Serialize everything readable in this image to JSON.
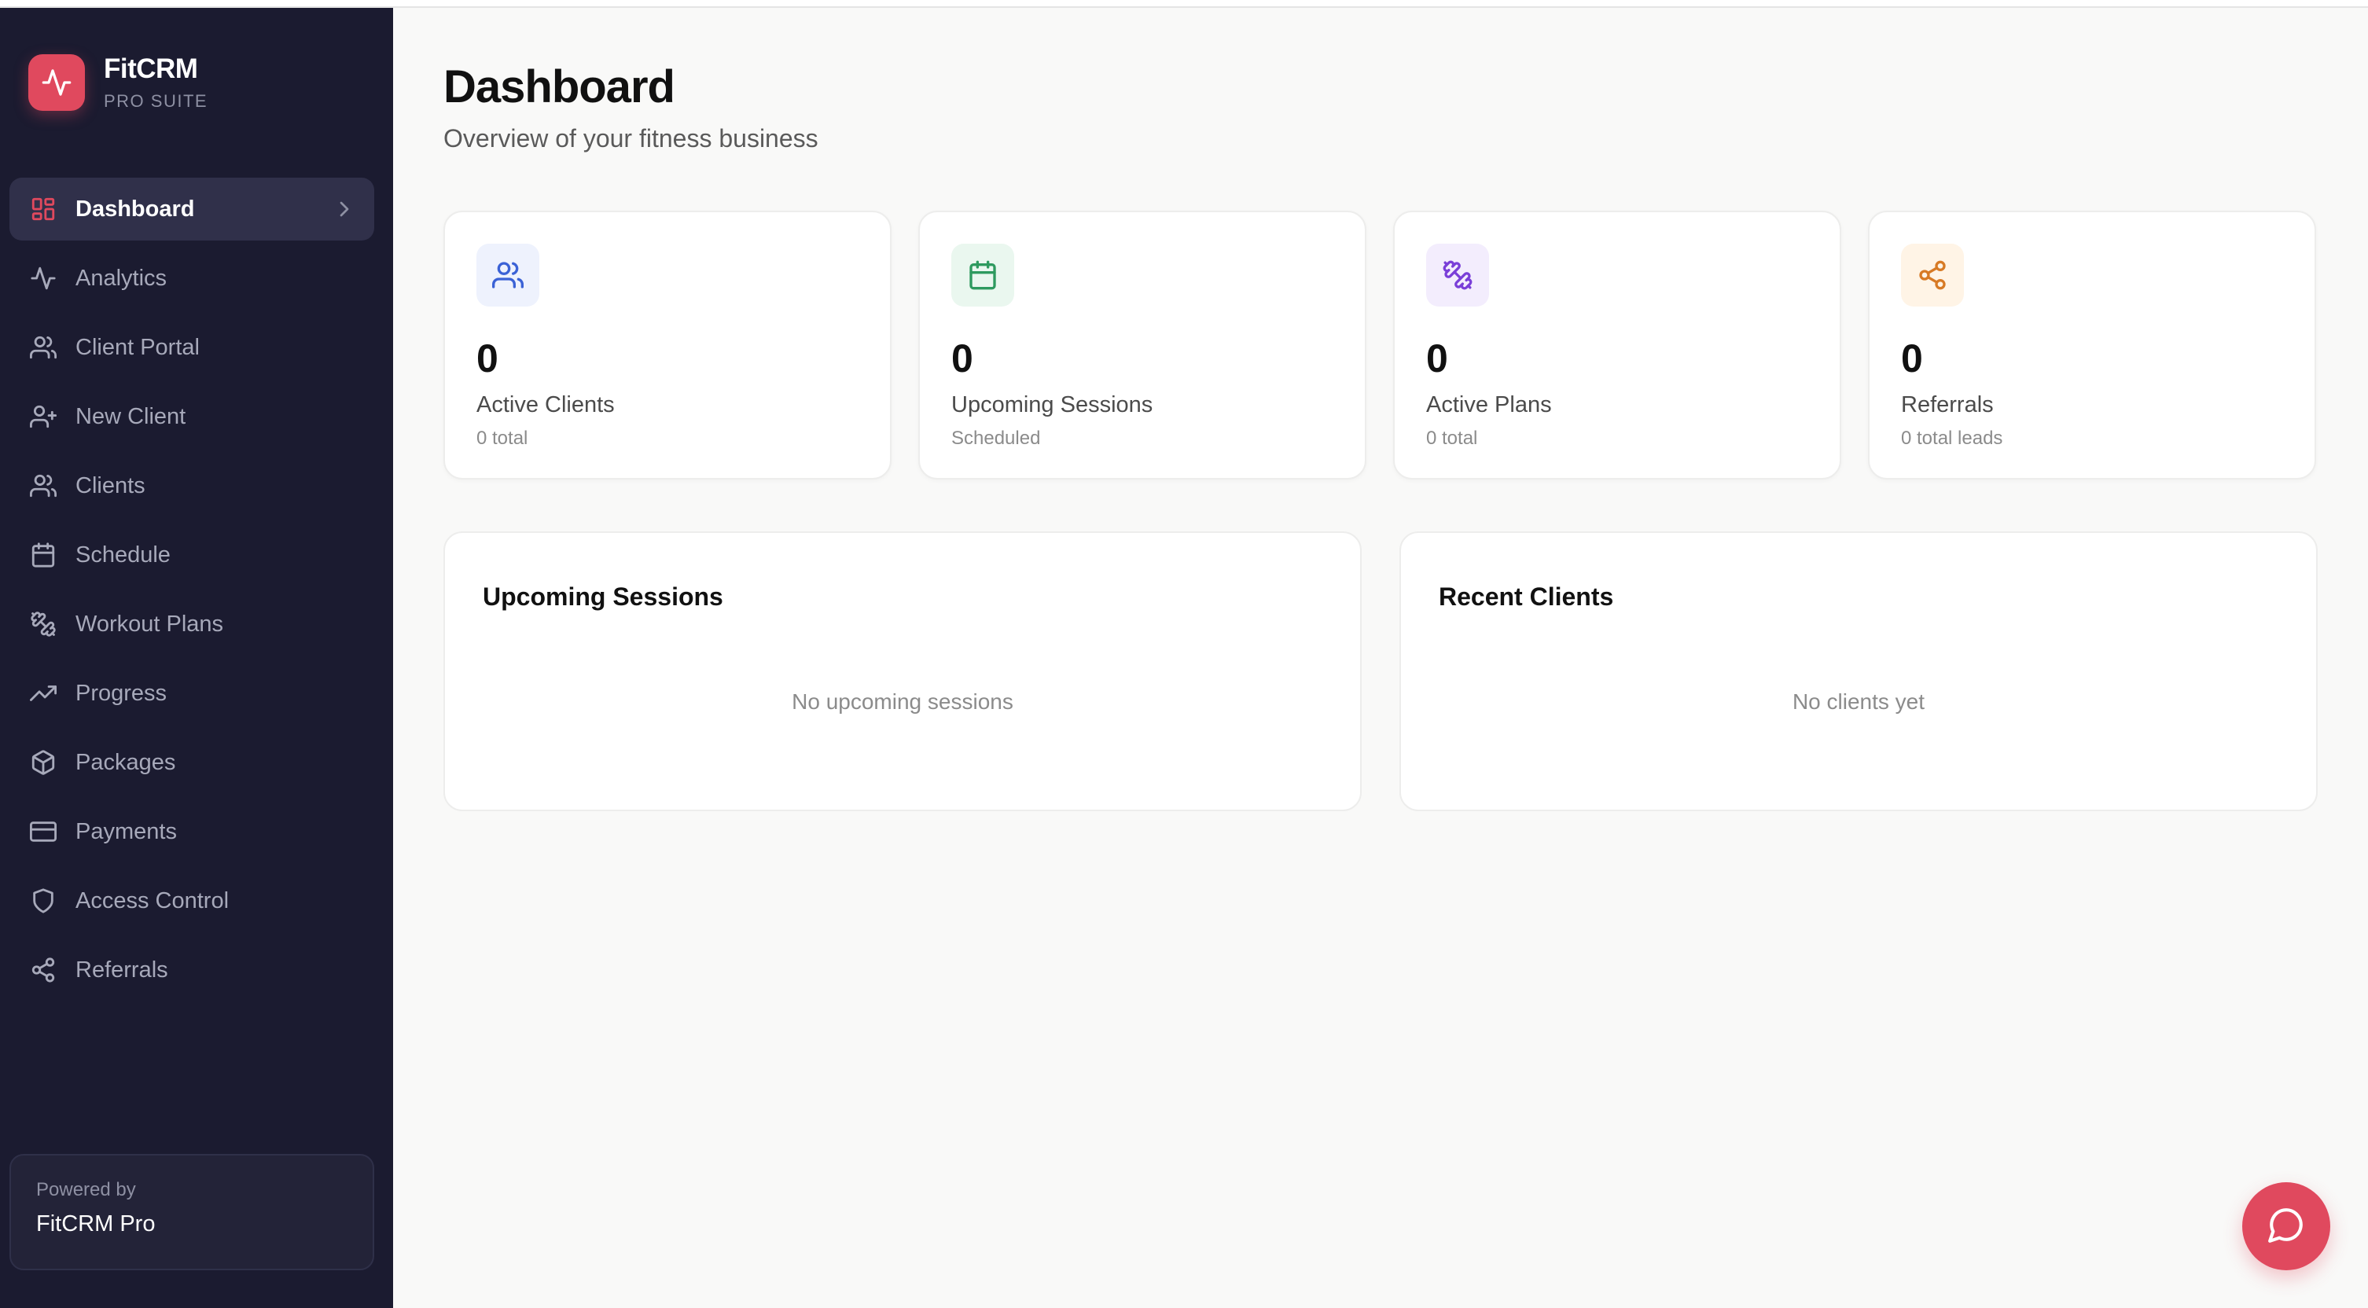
{
  "brand": {
    "name": "FitCRM",
    "subtitle": "PRO SUITE",
    "accent": "#e0495e"
  },
  "sidebar": {
    "items": [
      {
        "label": "Dashboard",
        "icon": "dashboard-grid-icon",
        "active": true
      },
      {
        "label": "Analytics",
        "icon": "activity-icon"
      },
      {
        "label": "Client Portal",
        "icon": "users-icon"
      },
      {
        "label": "New Client",
        "icon": "user-plus-icon"
      },
      {
        "label": "Clients",
        "icon": "users-icon"
      },
      {
        "label": "Schedule",
        "icon": "calendar-icon"
      },
      {
        "label": "Workout Plans",
        "icon": "dumbbell-icon"
      },
      {
        "label": "Progress",
        "icon": "trending-up-icon"
      },
      {
        "label": "Packages",
        "icon": "package-icon"
      },
      {
        "label": "Payments",
        "icon": "credit-card-icon"
      },
      {
        "label": "Access Control",
        "icon": "shield-icon"
      },
      {
        "label": "Referrals",
        "icon": "share-icon"
      }
    ],
    "powered": {
      "by": "Powered by",
      "name": "FitCRM Pro"
    }
  },
  "main": {
    "title": "Dashboard",
    "subtitle": "Overview of your fitness business",
    "stats": [
      {
        "value": "0",
        "label": "Active Clients",
        "sub": "0 total",
        "icon": "users-icon",
        "color": "#3b62d6",
        "bg": "#eef2fd"
      },
      {
        "value": "0",
        "label": "Upcoming Sessions",
        "sub": "Scheduled",
        "icon": "calendar-icon",
        "color": "#2e9a5f",
        "bg": "#eaf7ef"
      },
      {
        "value": "0",
        "label": "Active Plans",
        "sub": "0 total",
        "icon": "dumbbell-icon",
        "color": "#7a3fd8",
        "bg": "#f3edfd"
      },
      {
        "value": "0",
        "label": "Referrals",
        "sub": "0 total leads",
        "icon": "share-icon",
        "color": "#d77a25",
        "bg": "#fff4e6"
      }
    ],
    "panels": [
      {
        "title": "Upcoming Sessions",
        "empty": "No upcoming sessions"
      },
      {
        "title": "Recent Clients",
        "empty": "No clients yet"
      }
    ]
  },
  "chat": {
    "icon": "chat-bubble-icon"
  }
}
